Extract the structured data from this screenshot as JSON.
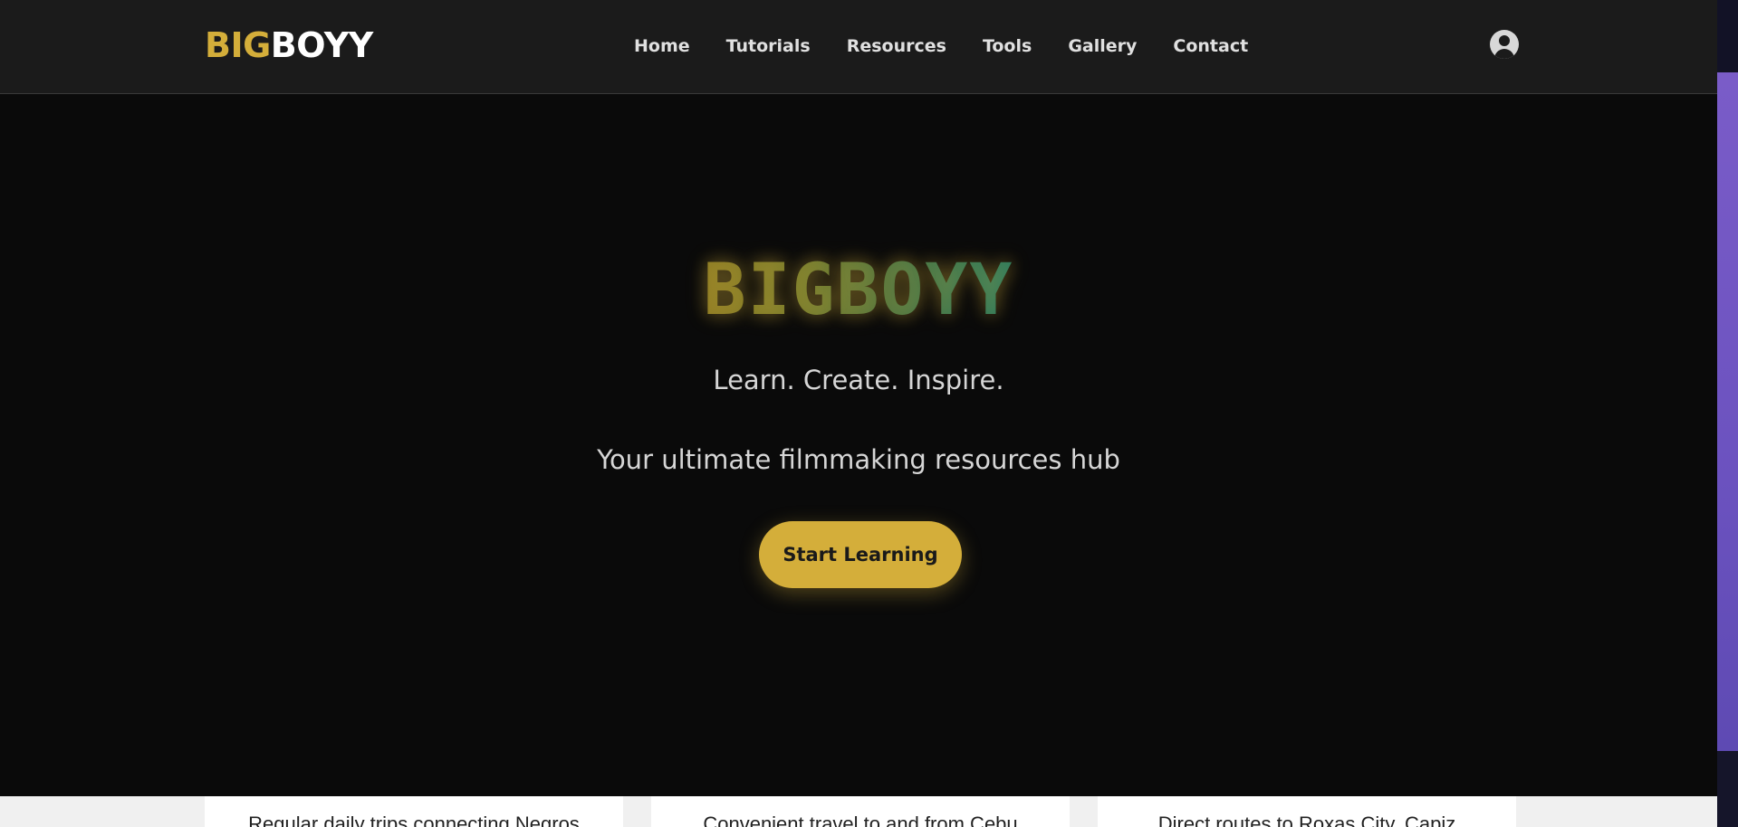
{
  "header": {
    "logo_part1": "BIG",
    "logo_part2": "BOYY",
    "nav": [
      {
        "label": "Home"
      },
      {
        "label": "Tutorials"
      },
      {
        "label": "Resources"
      },
      {
        "label": "Tools"
      },
      {
        "label": "Gallery"
      },
      {
        "label": "Contact"
      }
    ],
    "user_icon": "user-circle-icon"
  },
  "hero": {
    "title": "BIGBOYY",
    "tagline": "Learn. Create. Inspire.",
    "subtitle": "Your ultimate filmmaking resources hub",
    "cta_label": "Start Learning"
  },
  "underlying": {
    "cards": [
      {
        "text": "Regular daily trips connecting Negros"
      },
      {
        "text": "Convenient travel to and from Cebu"
      },
      {
        "text": "Direct routes to Roxas City, Capiz"
      }
    ]
  },
  "colors": {
    "accent": "#d4ae3a",
    "header_bg": "#1b1b1b",
    "page_bg": "#0a0a0a",
    "scroll_thumb": "#7a5cc8"
  }
}
